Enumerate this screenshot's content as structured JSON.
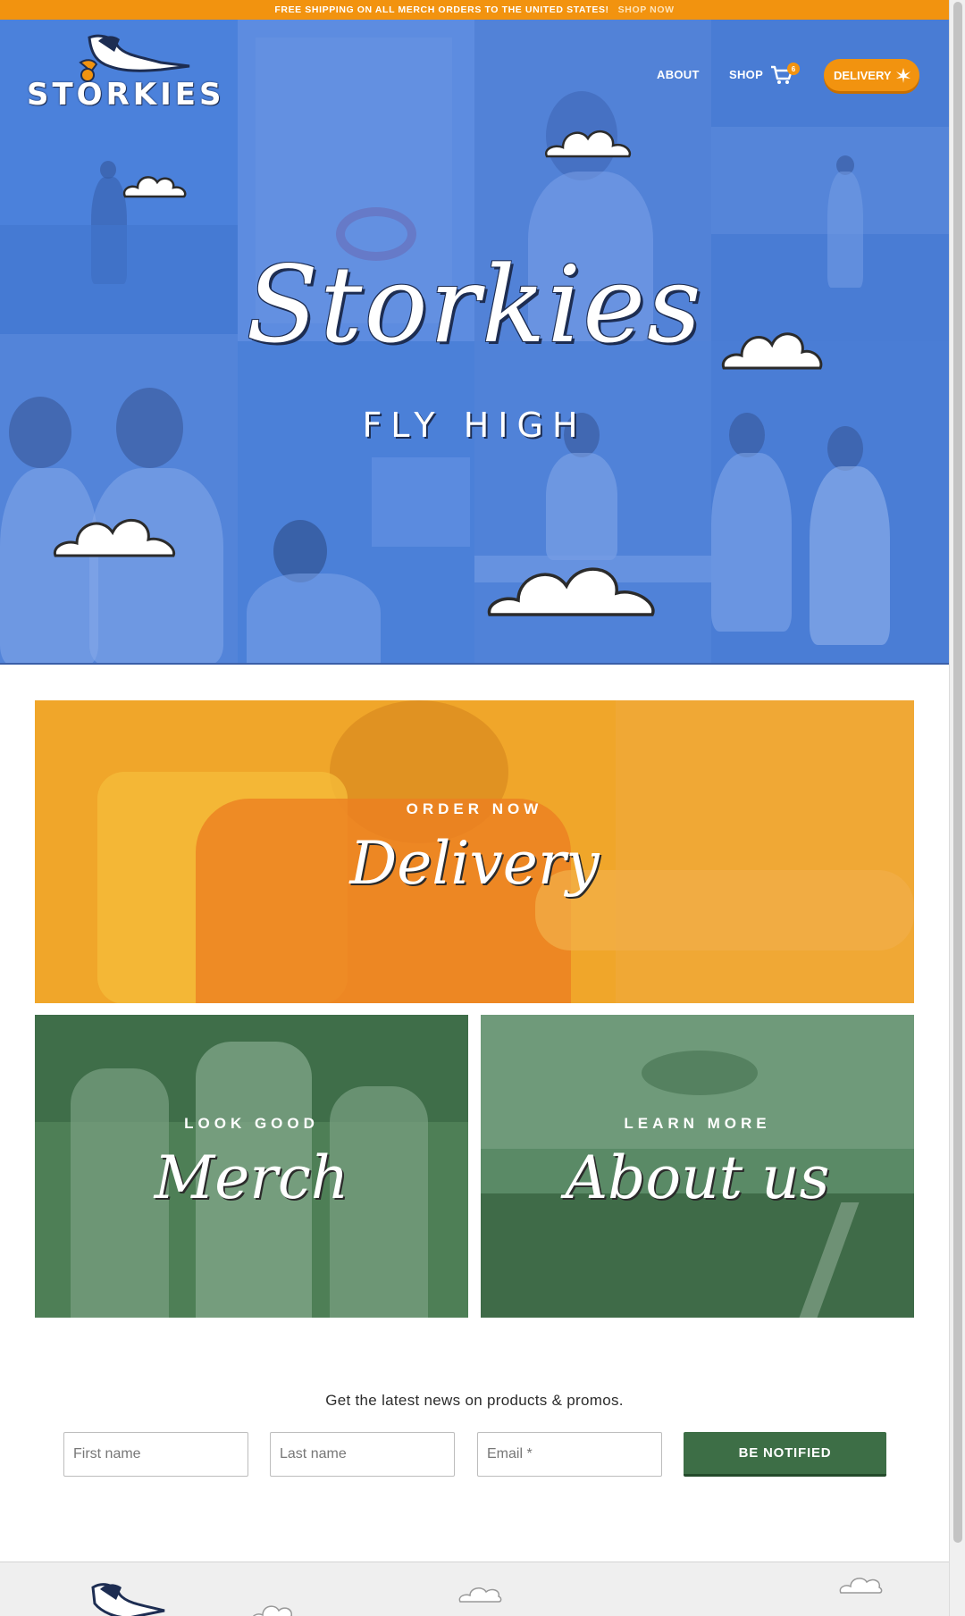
{
  "announcement": {
    "text": "FREE SHIPPING ON ALL MERCH ORDERS TO THE UNITED STATES!",
    "link": "SHOP NOW"
  },
  "brand": {
    "logo_text": "STORKIES"
  },
  "nav": {
    "about": "ABOUT",
    "shop": "SHOP",
    "cart_count": "6",
    "delivery": "DELIVERY"
  },
  "hero": {
    "title": "Storkies",
    "subtitle": "FLY HIGH"
  },
  "promos": {
    "delivery": {
      "kicker": "ORDER NOW",
      "headline": "Delivery"
    },
    "merch": {
      "kicker": "LOOK GOOD",
      "headline": "Merch"
    },
    "about": {
      "kicker": "LEARN MORE",
      "headline": "About us"
    }
  },
  "newsletter": {
    "title": "Get the latest news on products & promos.",
    "first_name_placeholder": "First name",
    "last_name_placeholder": "Last name",
    "email_placeholder": "Email *",
    "button": "BE NOTIFIED"
  },
  "colors": {
    "accent_orange": "#f2930f",
    "hero_blue": "#5f8fe0",
    "merch_green": "#3d6e46"
  },
  "icons": [
    "cart-icon",
    "cannabis-leaf-icon",
    "stork-icon",
    "cloud-icon"
  ]
}
